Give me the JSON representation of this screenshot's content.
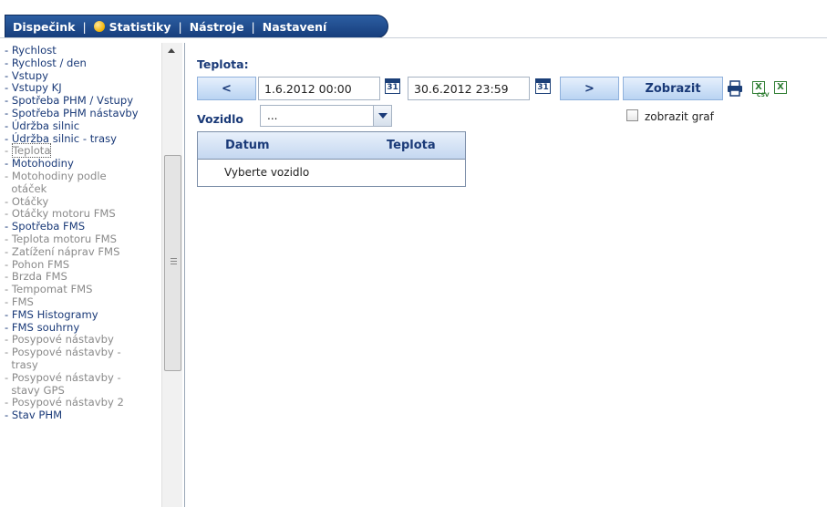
{
  "nav": {
    "items": [
      "Dispečink",
      "Statistiky",
      "Nástroje",
      "Nastavení"
    ],
    "separator": "|",
    "active": "Statistiky"
  },
  "sidebar": {
    "items": [
      {
        "label": "Rychlost",
        "style": "on"
      },
      {
        "label": "Rychlost / den",
        "style": "on"
      },
      {
        "label": "Vstupy",
        "style": "on"
      },
      {
        "label": "Vstupy KJ",
        "style": "on"
      },
      {
        "label": "Spotřeba PHM / Vstupy",
        "style": "on"
      },
      {
        "label": "Spotřeba PHM nástavby",
        "style": "on"
      },
      {
        "label": "Údržba silnic",
        "style": "on"
      },
      {
        "label": "Údržba silnic - trasy",
        "style": "on"
      },
      {
        "label": "Teplota",
        "style": "off",
        "selected": true
      },
      {
        "label": "Motohodiny",
        "style": "on"
      },
      {
        "label": "Motohodiny podle",
        "style": "off"
      },
      {
        "label": "otáček",
        "style": "off",
        "continuation": true
      },
      {
        "label": "Otáčky",
        "style": "off"
      },
      {
        "label": "Otáčky motoru FMS",
        "style": "off"
      },
      {
        "label": "Spotřeba FMS",
        "style": "on"
      },
      {
        "label": "Teplota motoru FMS",
        "style": "off"
      },
      {
        "label": "Zatížení náprav FMS",
        "style": "off"
      },
      {
        "label": "Pohon FMS",
        "style": "off"
      },
      {
        "label": "Brzda FMS",
        "style": "off"
      },
      {
        "label": "Tempomat FMS",
        "style": "off"
      },
      {
        "label": "FMS",
        "style": "off"
      },
      {
        "label": "FMS Histogramy",
        "style": "on"
      },
      {
        "label": "FMS souhrny",
        "style": "on"
      },
      {
        "label": "Posypové nástavby",
        "style": "off"
      },
      {
        "label": "Posypové nástavby -",
        "style": "off"
      },
      {
        "label": "trasy",
        "style": "off",
        "continuation": true
      },
      {
        "label": "Posypové nástavby -",
        "style": "off"
      },
      {
        "label": "stavy GPS",
        "style": "off",
        "continuation": true
      },
      {
        "label": "Posypové nástavby 2",
        "style": "off"
      },
      {
        "label": "Stav PHM",
        "style": "on"
      }
    ]
  },
  "main": {
    "title": "Teplota:",
    "prev_label": "<",
    "next_label": ">",
    "date_from": "1.6.2012 00:00",
    "date_to": "30.6.2012 23:59",
    "calendar_day": "31",
    "show_label": "Zobrazit",
    "vehicle_label": "Vozidlo",
    "vehicle_value": "...",
    "chart_checkbox_label": "zobrazit graf",
    "chart_checkbox_checked": false,
    "table": {
      "columns": [
        "Datum",
        "Teplota"
      ],
      "empty_message": "Vyberte vozidlo"
    },
    "icons": [
      "printer-icon",
      "excel-csv-icon",
      "excel-icon"
    ],
    "csv_tag": "CSV"
  },
  "colors": {
    "nav_bg": "#1f4b8f",
    "link": "#1a3a78",
    "muted": "#8a8a8a",
    "button_bg": "#c9dcf4",
    "active_dot": "#f2b100"
  }
}
